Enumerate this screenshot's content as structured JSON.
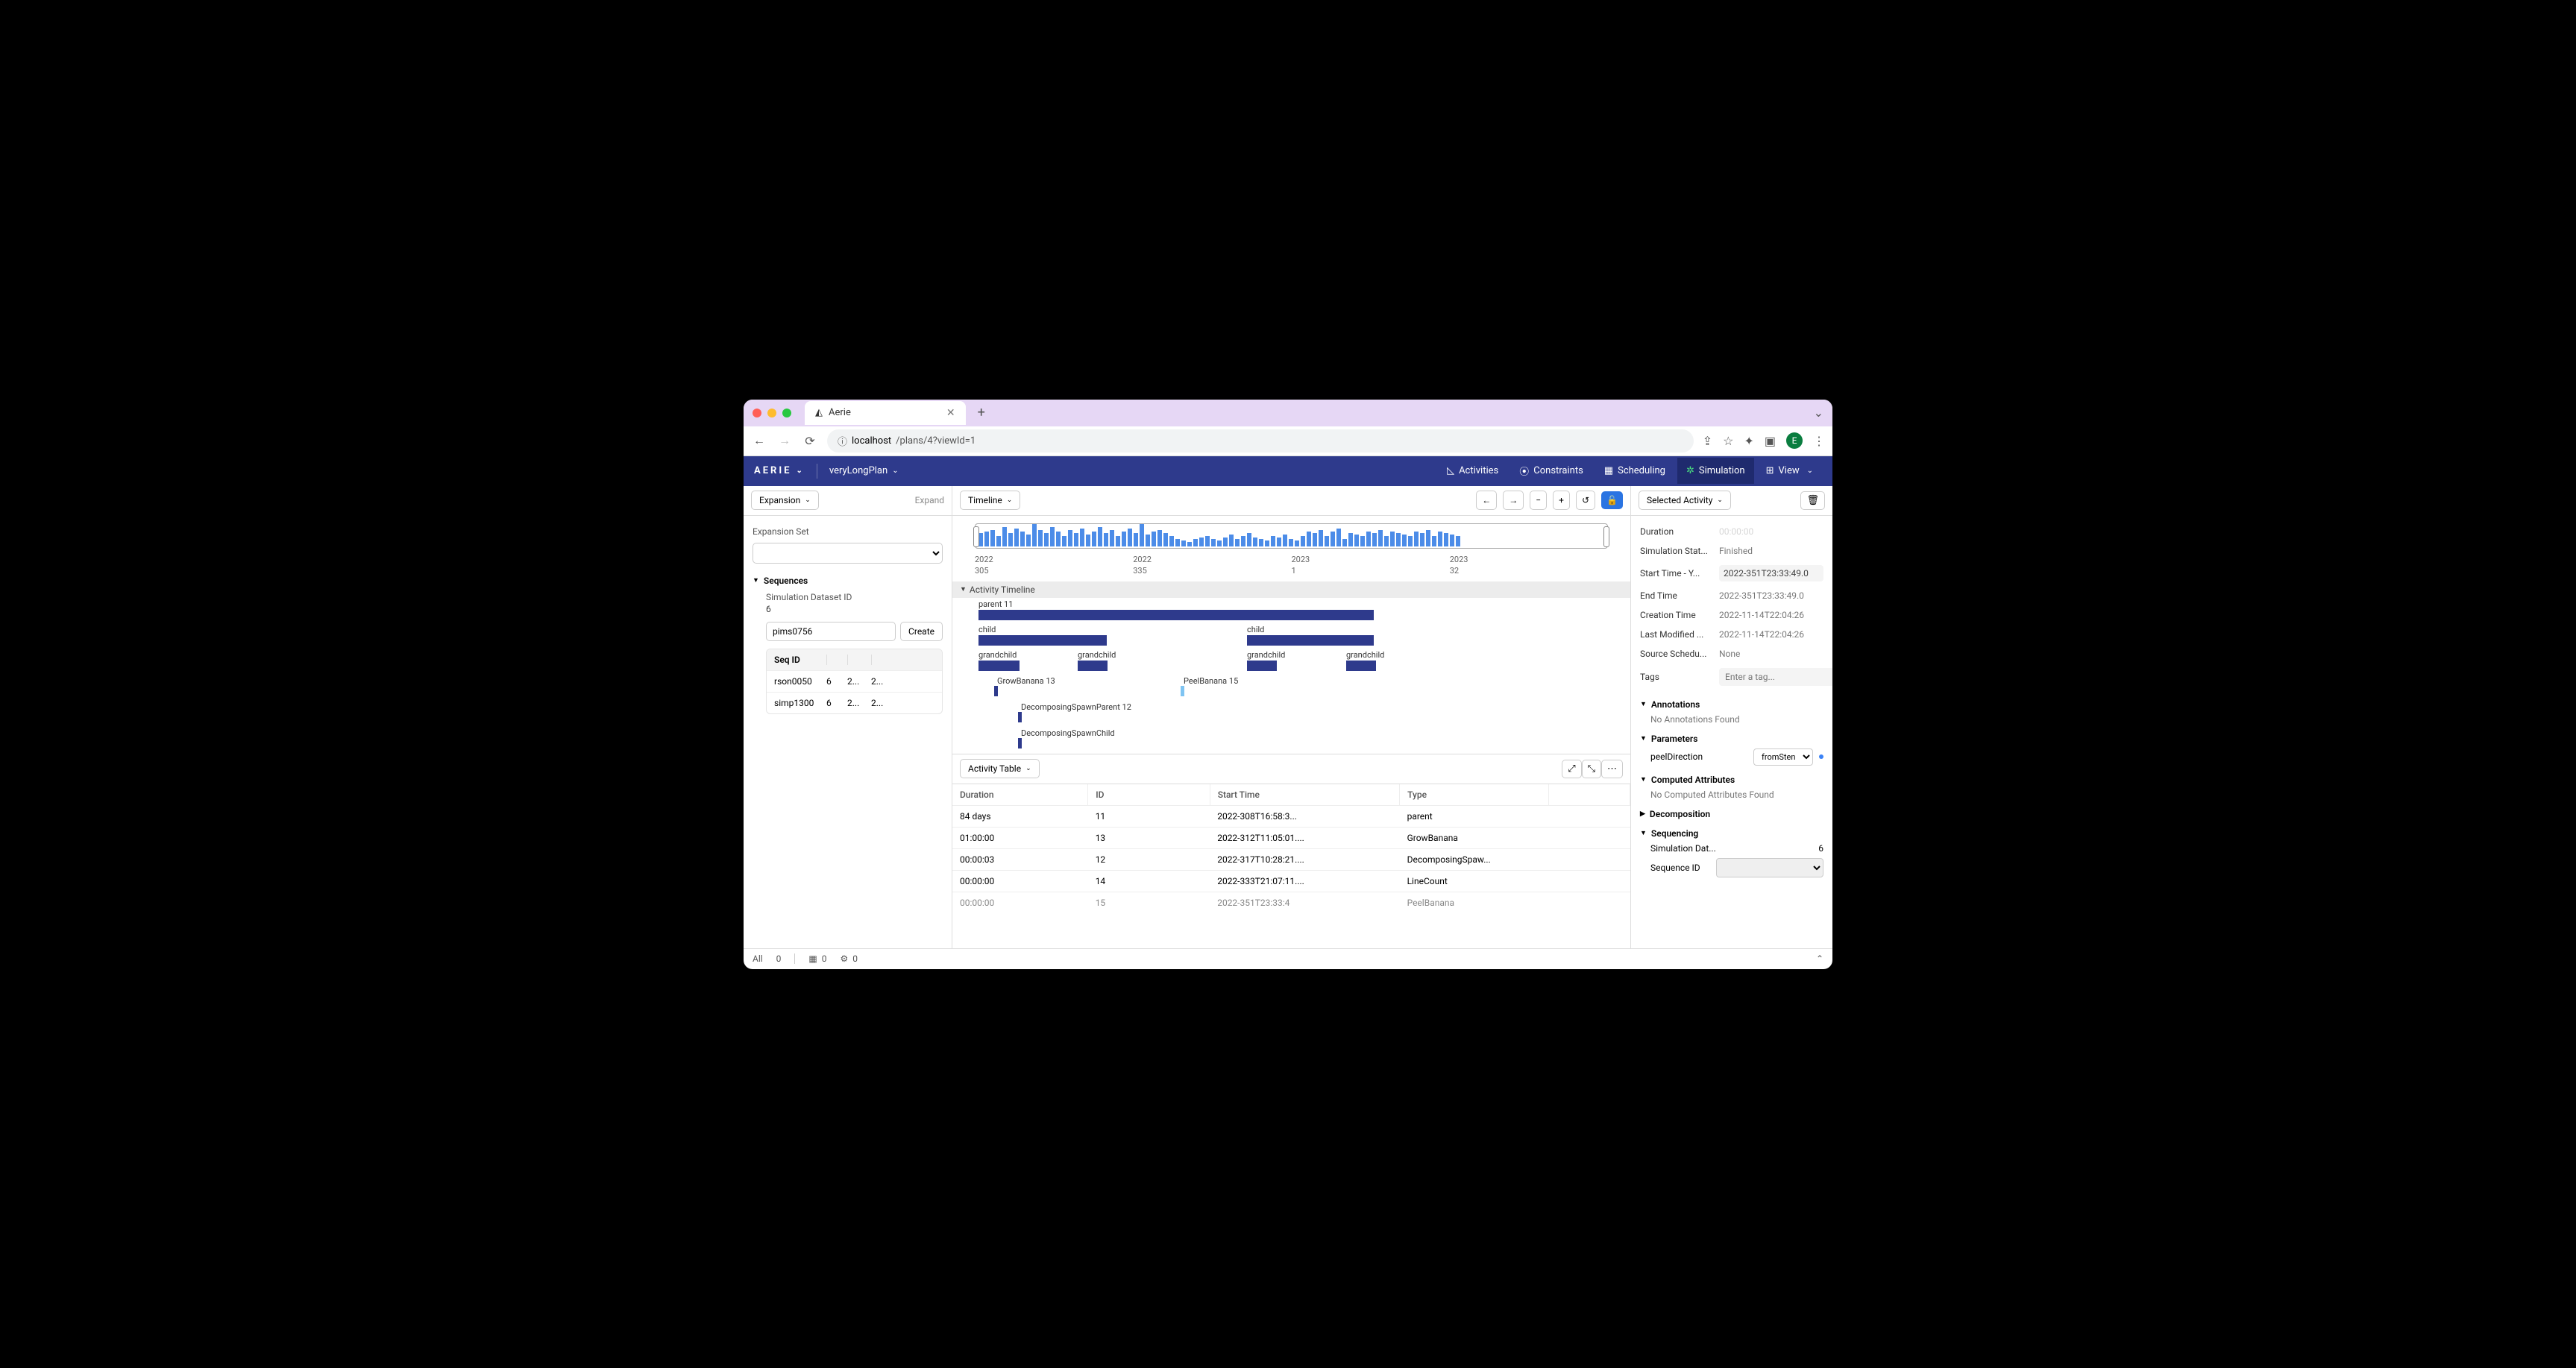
{
  "browser": {
    "tab_title": "Aerie",
    "url_prefix": "localhost",
    "url_path": "/plans/4?viewId=1",
    "avatar_letter": "E"
  },
  "header": {
    "logo": "AERIE",
    "plan_name": "veryLongPlan",
    "nav": {
      "activities": "Activities",
      "constraints": "Constraints",
      "scheduling": "Scheduling",
      "simulation": "Simulation",
      "view": "View"
    }
  },
  "left": {
    "dropdown": "Expansion",
    "expand_link": "Expand",
    "expansion_set_label": "Expansion Set",
    "sequences_label": "Sequences",
    "sim_dataset_label": "Simulation Dataset ID",
    "sim_dataset_val": "6",
    "seq_name_input": "pims0756",
    "create_btn": "Create",
    "seq_table": {
      "header": "Seq ID",
      "rows": [
        {
          "id": "rson0050",
          "c2": "6",
          "c3": "2...",
          "c4": "2..."
        },
        {
          "id": "simp1300",
          "c2": "6",
          "c3": "2...",
          "c4": "2..."
        }
      ]
    }
  },
  "center": {
    "timeline_dropdown": "Timeline",
    "axis": [
      {
        "y": "2022",
        "d": "305"
      },
      {
        "y": "2022",
        "d": "335"
      },
      {
        "y": "2023",
        "d": "1"
      },
      {
        "y": "2023",
        "d": "32"
      }
    ],
    "section_label": "Activity Timeline",
    "bars": {
      "parent": "parent 11",
      "child": "child",
      "grandchild": "grandchild",
      "grow": "GrowBanana 13",
      "peel": "PeelBanana 15",
      "dsp": "DecomposingSpawnParent 12",
      "dsc": "DecomposingSpawnChild"
    },
    "table_dropdown": "Activity Table",
    "columns": {
      "dur": "Duration",
      "id": "ID",
      "start": "Start Time",
      "type": "Type"
    },
    "rows": [
      {
        "dur": "84 days",
        "id": "11",
        "start": "2022-308T16:58:3...",
        "type": "parent"
      },
      {
        "dur": "01:00:00",
        "id": "13",
        "start": "2022-312T11:05:01....",
        "type": "GrowBanana"
      },
      {
        "dur": "00:00:03",
        "id": "12",
        "start": "2022-317T10:28:21....",
        "type": "DecomposingSpaw..."
      },
      {
        "dur": "00:00:00",
        "id": "14",
        "start": "2022-333T21:07:11....",
        "type": "LineCount"
      },
      {
        "dur": "00:00:00",
        "id": "15",
        "start": "2022-351T23:33:4",
        "type": "PeelBanana",
        "selected": true,
        "partial": true
      }
    ]
  },
  "right": {
    "dropdown": "Selected Activity",
    "details": {
      "duration_label": "Duration",
      "duration_val": "00:00:00",
      "sim_label": "Simulation Stat...",
      "sim_val": "Finished",
      "start_label": "Start Time - Y...",
      "start_val": "2022-351T23:33:49.0",
      "end_label": "End Time",
      "end_val": "2022-351T23:33:49.0",
      "creation_label": "Creation Time",
      "creation_val": "2022-11-14T22:04:26",
      "modified_label": "Last Modified ...",
      "modified_val": "2022-11-14T22:04:26",
      "source_label": "Source Schedu...",
      "source_val": "None",
      "tags_label": "Tags",
      "tags_placeholder": "Enter a tag..."
    },
    "annotations_h": "Annotations",
    "annotations_none": "No Annotations Found",
    "parameters_h": "Parameters",
    "param_name": "peelDirection",
    "param_val": "fromSten",
    "computed_h": "Computed Attributes",
    "computed_none": "No Computed Attributes Found",
    "decomp_h": "Decomposition",
    "sequencing_h": "Sequencing",
    "seq_sim_label": "Simulation Dat...",
    "seq_sim_val": "6",
    "seq_id_label": "Sequence ID"
  },
  "status": {
    "all_label": "All",
    "all_count": "0",
    "cal_count": "0",
    "gear_count": "0"
  }
}
